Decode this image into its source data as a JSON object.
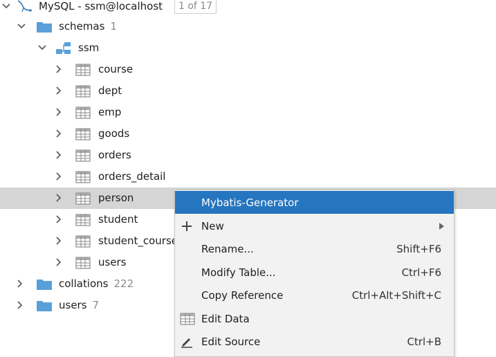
{
  "connection": {
    "label": "MySQL - ssm@localhost",
    "badge": "1 of 17"
  },
  "tree": {
    "schemas": {
      "label": "schemas",
      "count": "1"
    },
    "ssm": {
      "label": "ssm"
    },
    "tables": [
      "course",
      "dept",
      "emp",
      "goods",
      "orders",
      "orders_detail",
      "person",
      "student",
      "student_course",
      "users"
    ],
    "selected_table": "person",
    "collations": {
      "label": "collations",
      "count": "222"
    },
    "users": {
      "label": "users",
      "count": "7"
    }
  },
  "context_menu": {
    "highlighted": "Mybatis-Generator",
    "items": [
      {
        "label": "Mybatis-Generator",
        "shortcut": ""
      },
      {
        "label": "New",
        "shortcut": "",
        "icon": "plus-icon",
        "submenu": true
      },
      {
        "label": "Rename...",
        "shortcut": "Shift+F6"
      },
      {
        "label": "Modify Table...",
        "shortcut": "Ctrl+F6"
      },
      {
        "label": "Copy Reference",
        "shortcut": "Ctrl+Alt+Shift+C"
      },
      {
        "label": "Edit Data",
        "shortcut": "",
        "icon": "table-grid-icon"
      },
      {
        "label": "Edit Source",
        "shortcut": "Ctrl+B",
        "icon": "pencil-icon"
      }
    ]
  },
  "colors": {
    "selection": "#d5d5d5",
    "menu_highlight": "#2675bf",
    "folder": "#5aa0d8",
    "table_icon": "#8a8a8a"
  }
}
